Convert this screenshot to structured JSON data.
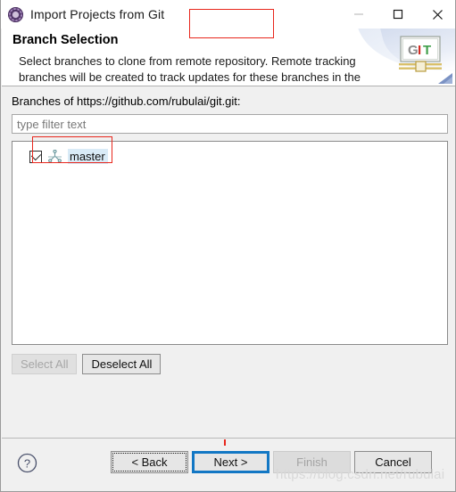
{
  "window": {
    "title": "Import Projects from Git",
    "title_icon": "gear-icon",
    "controls": {
      "minimize": "—",
      "maximize": "□",
      "close": "✕"
    }
  },
  "header": {
    "title": "Branch Selection",
    "description": "Select branches to clone from remote repository. Remote tracking\nbranches will be created to track updates for these branches in the",
    "logo": {
      "g": "G",
      "i": "I",
      "t": "T"
    }
  },
  "main": {
    "branches_label": "Branches of https://github.com/rubulai/git.git:",
    "filter": {
      "value": "",
      "placeholder": "type filter text"
    },
    "tree": {
      "items": [
        {
          "label": "master",
          "checked": true,
          "icon": "git-branch-icon"
        }
      ]
    },
    "buttons": {
      "select_all": "Select All",
      "select_all_enabled": false,
      "deselect_all": "Deselect All",
      "deselect_all_enabled": true
    }
  },
  "footer": {
    "help": "?",
    "back": "< Back",
    "next": "Next >",
    "finish": "Finish",
    "cancel": "Cancel"
  },
  "watermark": "https://blog.csdn.net/rubulai",
  "colors": {
    "accent_blue": "#1277c4",
    "annotation_red": "#e8261c",
    "selection_blue": "#d9ebf7",
    "dialog_bg": "#f0f0f0"
  }
}
